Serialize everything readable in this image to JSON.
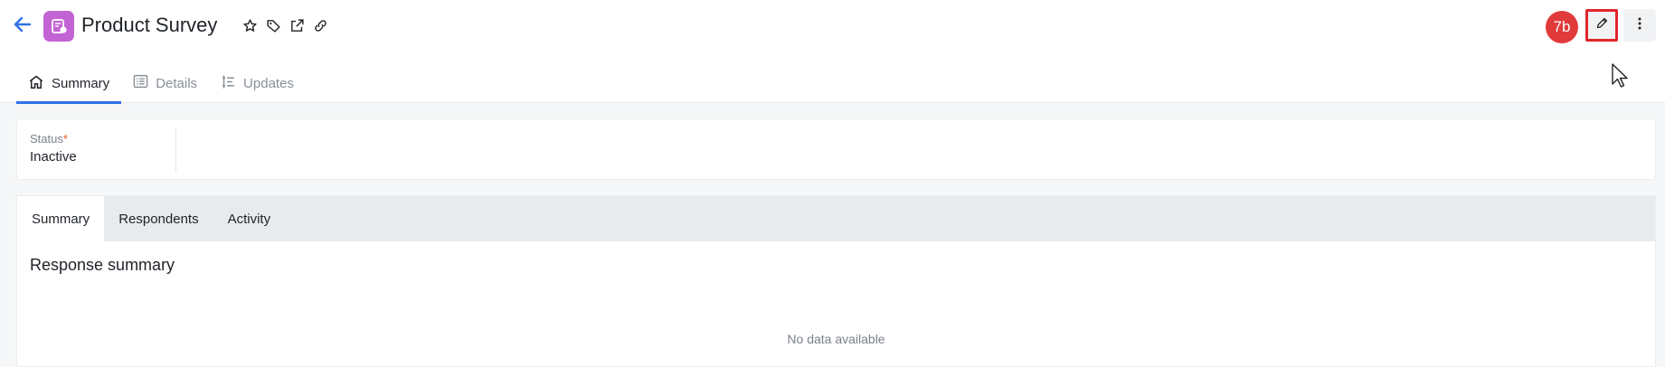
{
  "header": {
    "title": "Product Survey",
    "badge": "7b"
  },
  "icons": {
    "back": "arrow-left-icon",
    "app": "survey-icon",
    "favorite": "star-icon",
    "tag": "tag-icon",
    "open_external": "external-link-icon",
    "link": "link-icon",
    "edit": "pencil-icon",
    "more": "more-vertical-icon"
  },
  "top_tabs": [
    {
      "label": "Summary",
      "icon": "home-icon",
      "active": true
    },
    {
      "label": "Details",
      "icon": "list-icon",
      "active": false
    },
    {
      "label": "Updates",
      "icon": "timeline-icon",
      "active": false
    }
  ],
  "status": {
    "label": "Status",
    "required_mark": "*",
    "value": "Inactive"
  },
  "inner_tabs": [
    {
      "label": "Summary",
      "active": true
    },
    {
      "label": "Respondents",
      "active": false
    },
    {
      "label": "Activity",
      "active": false
    }
  ],
  "summary": {
    "title": "Response summary",
    "empty_text": "No data available"
  },
  "colors": {
    "accent": "#2f6fe4",
    "app_icon": "#c264d4",
    "badge": "#e03a3a",
    "highlight_border": "#e0262c"
  }
}
